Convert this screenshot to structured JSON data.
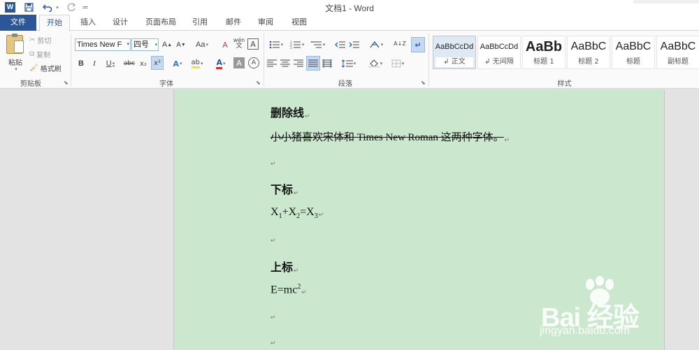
{
  "window": {
    "title": "文档1 - Word"
  },
  "quick_access": {
    "word_icon": "W",
    "save_icon": "save-icon",
    "undo_icon": "undo-icon",
    "redo_icon": "redo-icon",
    "customize_icon": "="
  },
  "tabs": [
    {
      "label": "文件"
    },
    {
      "label": "开始"
    },
    {
      "label": "插入"
    },
    {
      "label": "设计"
    },
    {
      "label": "页面布局"
    },
    {
      "label": "引用"
    },
    {
      "label": "邮件"
    },
    {
      "label": "审阅"
    },
    {
      "label": "视图"
    }
  ],
  "ribbon": {
    "clipboard": {
      "paste": "粘贴",
      "cut": "剪切",
      "copy": "复制",
      "format_painter": "格式刷",
      "label": "剪贴板"
    },
    "font": {
      "font_name": "Times New F",
      "font_size": "四号",
      "grow": "A",
      "shrink": "A",
      "change_case": "Aa",
      "clear_format": "A",
      "phonetic": "wén",
      "char_border": "A",
      "bold": "B",
      "italic": "I",
      "underline": "U",
      "strike": "abc",
      "subscript": "x₂",
      "superscript": "x²",
      "effects": "A",
      "highlight": "ab",
      "font_color": "A",
      "shading": "A",
      "enclose": "A",
      "label": "字体"
    },
    "paragraph": {
      "label": "段落",
      "sort": "A↓Z"
    },
    "styles": {
      "label": "样式",
      "items": [
        {
          "preview": "AaBbCcDd",
          "name": "↲ 正文"
        },
        {
          "preview": "AaBbCcDd",
          "name": "↲ 无间隔"
        },
        {
          "preview": "AaBb",
          "name": "标题 1"
        },
        {
          "preview": "AaBbC",
          "name": "标题 2"
        },
        {
          "preview": "AaBbC",
          "name": "标题"
        },
        {
          "preview": "AaBbC",
          "name": "副标题"
        }
      ]
    }
  },
  "document": {
    "strike_heading": "删除线",
    "strike_text": "小小猪喜欢宋体和 Times New Roman 这两种字体。",
    "sub_heading": "下标",
    "sub_x1": "X",
    "sub_1": "1",
    "sub_plus": "+X",
    "sub_2": "2",
    "sub_eq": "=X",
    "sub_3": "3",
    "sup_heading": "上标",
    "sup_base": "E=mc",
    "sup_exp": "2",
    "para_mark": "↵"
  },
  "watermark": {
    "brand": "Bai  经验",
    "url": "jingyan.baidu.com"
  },
  "colors": {
    "accent": "#2b579a",
    "page_bg": "#cbe8ce",
    "ribbon_bg": "#fafafa"
  }
}
